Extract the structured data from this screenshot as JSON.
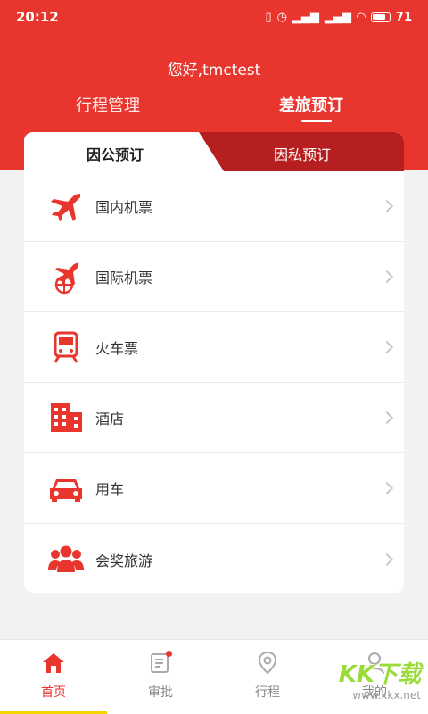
{
  "status": {
    "time": "20:12",
    "battery": "71"
  },
  "header": {
    "greeting": "您好,tmctest",
    "tabs": [
      "行程管理",
      "差旅预订"
    ]
  },
  "subtabs": {
    "public": "因公预订",
    "private": "因私预订"
  },
  "menu": [
    {
      "label": "国内机票",
      "icon": "plane-icon"
    },
    {
      "label": "国际机票",
      "icon": "globe-plane-icon"
    },
    {
      "label": "火车票",
      "icon": "train-icon"
    },
    {
      "label": "酒店",
      "icon": "hotel-icon"
    },
    {
      "label": "用车",
      "icon": "car-icon"
    },
    {
      "label": "会奖旅游",
      "icon": "group-icon"
    }
  ],
  "nav": [
    {
      "label": "首页",
      "icon": "home-icon"
    },
    {
      "label": "审批",
      "icon": "approval-icon"
    },
    {
      "label": "行程",
      "icon": "location-icon"
    },
    {
      "label": "我的",
      "icon": "user-icon"
    }
  ],
  "watermark": {
    "logo": "KK下载",
    "url": "www.kkx.net"
  },
  "colors": {
    "brand": "#e8362e",
    "dark_red": "#b51f1f"
  }
}
